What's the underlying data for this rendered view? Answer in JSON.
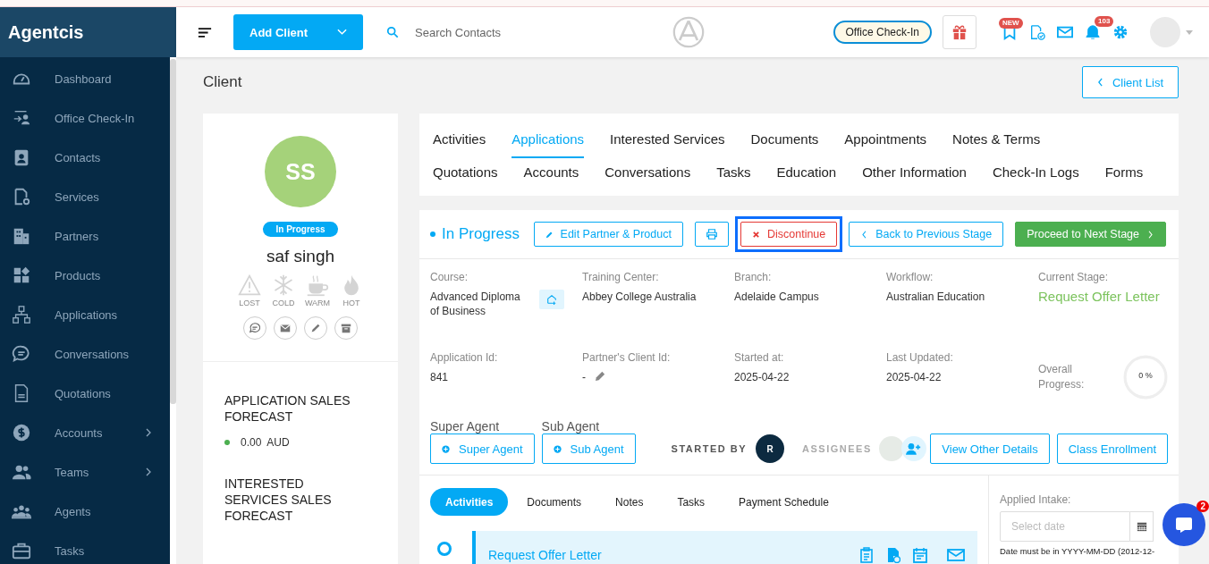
{
  "sidebar": {
    "brand": "Agentcis",
    "items": [
      {
        "label": "Dashboard",
        "has_submenu": false
      },
      {
        "label": "Office Check-In",
        "has_submenu": false
      },
      {
        "label": "Contacts",
        "has_submenu": false
      },
      {
        "label": "Services",
        "has_submenu": false
      },
      {
        "label": "Partners",
        "has_submenu": false
      },
      {
        "label": "Products",
        "has_submenu": false
      },
      {
        "label": "Applications",
        "has_submenu": false
      },
      {
        "label": "Conversations",
        "has_submenu": false
      },
      {
        "label": "Quotations",
        "has_submenu": false
      },
      {
        "label": "Accounts",
        "has_submenu": true
      },
      {
        "label": "Teams",
        "has_submenu": true
      },
      {
        "label": "Agents",
        "has_submenu": false
      },
      {
        "label": "Tasks",
        "has_submenu": false
      }
    ]
  },
  "topbar": {
    "add_button": "Add Client",
    "search": {
      "placeholder": "Search Contacts"
    },
    "office_checkin": "Office Check-In",
    "new_badge": "NEW",
    "notification_count": "103"
  },
  "page": {
    "title": "Client",
    "client_list_button": "Client List"
  },
  "client": {
    "initials": "SS",
    "status": "In Progress",
    "name": "saf singh",
    "ratings": [
      {
        "label": "LOST",
        "selected": false
      },
      {
        "label": "COLD",
        "selected": false
      },
      {
        "label": "WARM",
        "selected": false
      },
      {
        "label": "HOT",
        "selected": false
      }
    ],
    "forecasts": [
      {
        "title": "APPLICATION SALES FORECAST",
        "amount": "0.00",
        "currency": "AUD",
        "color": "#4caf50"
      },
      {
        "title": "INTERESTED SERVICES SALES FORECAST"
      }
    ]
  },
  "tab_rows": [
    {
      "tabs": [
        {
          "label": "Activities",
          "selected": false
        },
        {
          "label": "Applications",
          "selected": true
        },
        {
          "label": "Interested Services",
          "selected": false
        },
        {
          "label": "Documents",
          "selected": false
        },
        {
          "label": "Appointments",
          "selected": false
        },
        {
          "label": "Notes & Terms",
          "selected": false
        }
      ]
    },
    {
      "tabs": [
        {
          "label": "Quotations",
          "selected": false
        },
        {
          "label": "Accounts",
          "selected": false
        },
        {
          "label": "Conversations",
          "selected": false
        },
        {
          "label": "Tasks",
          "selected": false
        },
        {
          "label": "Education",
          "selected": false
        },
        {
          "label": "Other Information",
          "selected": false
        },
        {
          "label": "Check-In Logs",
          "selected": false
        },
        {
          "label": "Forms",
          "selected": false
        }
      ]
    }
  ],
  "application": {
    "status": "In Progress",
    "buttons": [
      {
        "kind": "edit",
        "label": "Edit Partner & Product",
        "focused": false
      },
      {
        "kind": "print",
        "focused": false
      },
      {
        "kind": "discontinue",
        "label": "Discontinue",
        "focused": true
      },
      {
        "kind": "back",
        "label": "Back to Previous Stage",
        "focused": false
      },
      {
        "kind": "proceed",
        "label": "Proceed to Next Stage",
        "focused": false
      }
    ],
    "fields": [
      {
        "kind": "course",
        "label": "Course:",
        "value": "Advanced Diploma of Business"
      },
      {
        "kind": "text",
        "label": "Training Center:",
        "value": "Abbey College Australia"
      },
      {
        "kind": "text",
        "label": "Branch:",
        "value": "Adelaide Campus"
      },
      {
        "kind": "text",
        "label": "Workflow:",
        "value": "Australian Education"
      },
      {
        "kind": "stage",
        "label": "Current Stage:",
        "value": "Request Offer Letter"
      },
      {
        "kind": "text",
        "label": "Application Id:",
        "value": "841"
      },
      {
        "kind": "editable",
        "label": "Partner's Client Id:",
        "value": "-"
      },
      {
        "kind": "text",
        "label": "Started at:",
        "value": "2025-04-22"
      },
      {
        "kind": "text",
        "label": "Last Updated:",
        "value": "2025-04-22"
      },
      {
        "kind": "progress",
        "label": "Overall Progress:",
        "value": "0 %",
        "level": 0
      }
    ],
    "agents": [
      {
        "label": "Super Agent",
        "button": "Super Agent"
      },
      {
        "label": "Sub Agent",
        "button": "Sub Agent"
      }
    ],
    "started_by": {
      "label": "STARTED BY",
      "initial": "R"
    },
    "assignees_label": "ASSIGNEES",
    "actions": [
      "View Other Details",
      "Class Enrollment"
    ],
    "subtabs": [
      {
        "label": "Activities",
        "selected": true
      },
      {
        "label": "Documents",
        "selected": false
      },
      {
        "label": "Notes",
        "selected": false
      },
      {
        "label": "Tasks",
        "selected": false
      },
      {
        "label": "Payment Schedule",
        "selected": false
      }
    ],
    "activity": {
      "title": "Request Offer Letter"
    },
    "intake": {
      "label": "Applied Intake:",
      "placeholder": "Select date",
      "hint": "Date must be in YYYY-MM-DD (2012-12-"
    }
  },
  "chat": {
    "badge": "2"
  }
}
